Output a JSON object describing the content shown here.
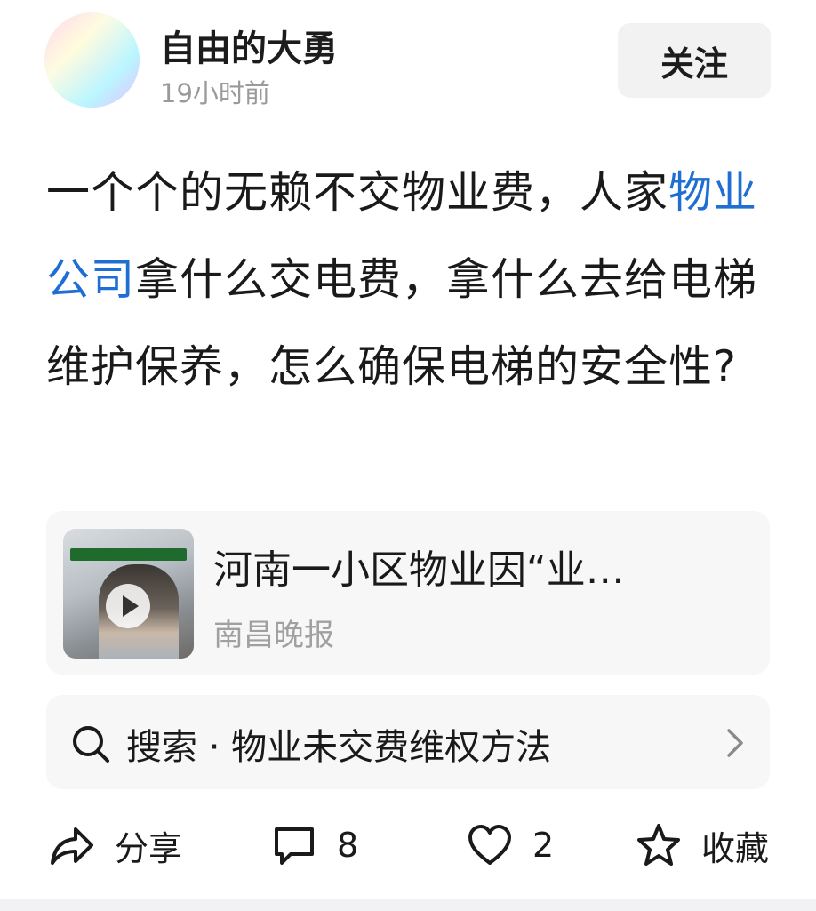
{
  "author": {
    "name": "自由的大勇",
    "time": "19小时前"
  },
  "follow_label": "关注",
  "post": {
    "before_link": "一个个的无赖不交物业费，人家",
    "link": "物业公司",
    "after_link": "拿什么交电费，拿什么去给电梯维护保养，怎么确保电梯的安全性?"
  },
  "card": {
    "title": "河南一小区物业因“业…",
    "source": "南昌晚报",
    "icon": "play-icon"
  },
  "search": {
    "text": "搜索 · 物业未交费维权方法",
    "icon": "search-icon"
  },
  "actions": {
    "share": "分享",
    "comments": "8",
    "likes": "2",
    "favorite": "收藏"
  },
  "colors": {
    "link": "#1f6ed4",
    "muted": "#9a9a9a",
    "card_bg": "#f7f7f8"
  }
}
